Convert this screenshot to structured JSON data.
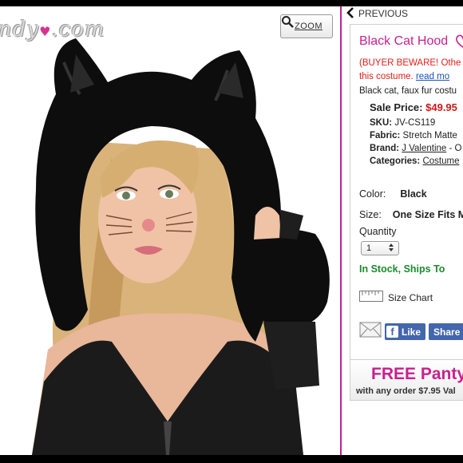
{
  "logo": {
    "text_left": "ndy",
    "heart": "♥",
    "text_right": ".com"
  },
  "zoom": {
    "label": "ZOOM",
    "icon": "magnifier-icon"
  },
  "nav": {
    "previous_label": "PREVIOUS",
    "icon": "chevron-left-icon"
  },
  "product": {
    "title": "Black Cat Hood",
    "wishlist_icon": "heart-outline-icon",
    "warning_line1": "(BUYER BEWARE! Othe",
    "warning_line2": "this costume.",
    "read_more": "read mo",
    "description": "Black cat, faux fur costu",
    "sale_label": "Sale Price:",
    "sale_price": "$49.95",
    "sku_label": "SKU:",
    "sku_value": "JV-CS119",
    "fabric_label": "Fabric:",
    "fabric_value": "Stretch Matte",
    "brand_label": "Brand:",
    "brand_value": "J Valentine",
    "brand_suffix": "- O",
    "categories_label": "Categories:",
    "categories_value": "Costume"
  },
  "options": {
    "color_label": "Color:",
    "color_value": "Black",
    "size_label": "Size:",
    "size_value": "One Size Fits M",
    "quantity_label": "Quantity",
    "quantity_value": "1",
    "stock": "In Stock, Ships To"
  },
  "size_chart": {
    "label": "Size Chart",
    "icon": "ruler-icon"
  },
  "social": {
    "email_icon": "envelope-icon",
    "like_label": "Like",
    "share_label": "Share"
  },
  "promo": {
    "headline": "FREE Panty",
    "subline": "with any order $7.95 Val"
  },
  "colors": {
    "brand_pink": "#c9208f",
    "sale_red": "#d01818",
    "stock_green": "#1d8a2e",
    "facebook_blue": "#4366ac"
  }
}
